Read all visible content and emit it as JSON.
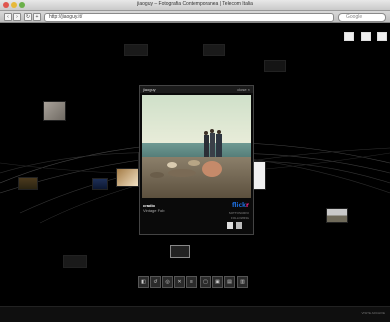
{
  "window": {
    "title": "jiaoguy – Fotografia Contemporanea | Telecom Italia"
  },
  "toolbar": {
    "url": "http://jiaoguy.it/",
    "search_placeholder": "Google",
    "back_icon": "arrow-left-icon",
    "forward_icon": "arrow-right-icon"
  },
  "popup": {
    "title": "jiaoguy",
    "close_label": "close ×",
    "author": "cradio",
    "subtitle": "Vintage Fob",
    "brand": {
      "main": "flick",
      "accent": "r"
    },
    "meta": [
      "SOTTOSCRIVI",
      "FOLLOWING"
    ]
  },
  "dock": {
    "buttons": [
      "◧",
      "↺",
      "◎",
      "✕",
      "≡",
      "▢",
      "▣",
      "▤",
      "▥"
    ]
  },
  "status": {
    "right_text": "VISITE ARCHIVE"
  },
  "colors": {
    "background": "#000000",
    "flickr_blue": "#1d6bd6",
    "flickr_pink": "#ff2a8f"
  }
}
